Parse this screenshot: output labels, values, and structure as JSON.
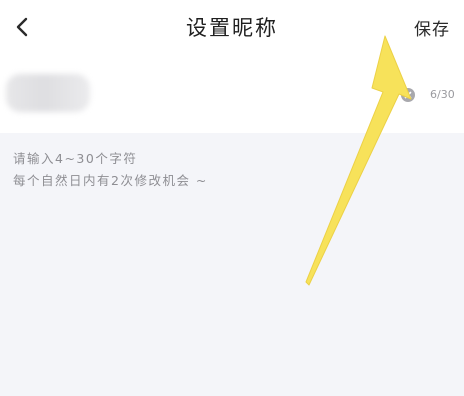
{
  "header": {
    "title": "设置昵称",
    "save_label": "保存"
  },
  "input": {
    "value": "",
    "char_count": "6/30"
  },
  "hints": [
    "请输入4~30个字符",
    "每个自然日内有2次修改机会 ~"
  ],
  "icons": {
    "back": "chevron-left-icon",
    "clear": "close-circle-icon",
    "annotation": "arrow-annotation"
  },
  "colors": {
    "page_background": "#f4f5f9",
    "arrow": "#f7e25a"
  }
}
